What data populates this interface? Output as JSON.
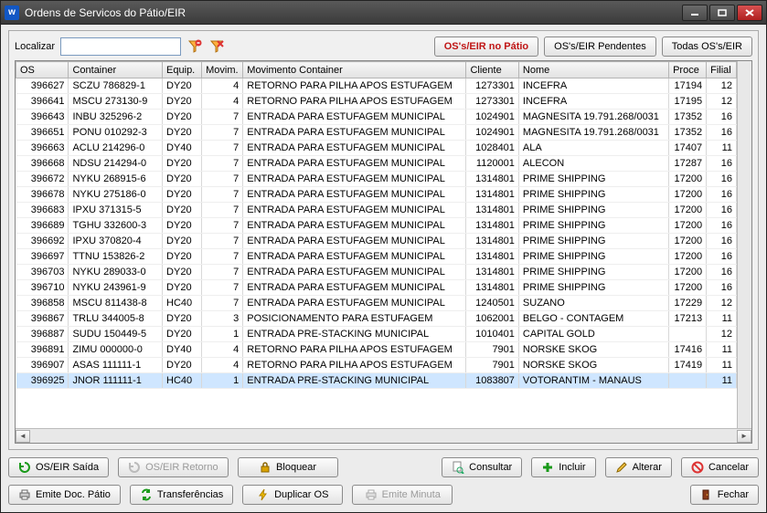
{
  "window": {
    "title": "Ordens de Servicos do Pátio/EIR"
  },
  "search": {
    "label": "Localizar",
    "value": ""
  },
  "filters": {
    "no_patio": "OS's/EIR no Pátio",
    "pendentes": "OS's/EIR Pendentes",
    "todas": "Todas OS's/EIR"
  },
  "columns": {
    "os": "OS",
    "container": "Container",
    "equip": "Equip.",
    "movim": "Movim.",
    "mov_container": "Movimento Container",
    "cliente": "Cliente",
    "nome": "Nome",
    "proce": "Proce",
    "filial": "Filial"
  },
  "rows": [
    {
      "os": "396627",
      "container": "SCZU 786829-1",
      "equip": "DY20",
      "movim": "4",
      "mov": "RETORNO PARA PILHA APOS ESTUFAGEM",
      "cliente": "1273301",
      "nome": "INCEFRA",
      "proce": "17194",
      "filial": "12"
    },
    {
      "os": "396641",
      "container": "MSCU 273130-9",
      "equip": "DY20",
      "movim": "4",
      "mov": "RETORNO PARA PILHA APOS ESTUFAGEM",
      "cliente": "1273301",
      "nome": "INCEFRA",
      "proce": "17195",
      "filial": "12"
    },
    {
      "os": "396643",
      "container": "INBU 325296-2",
      "equip": "DY20",
      "movim": "7",
      "mov": "ENTRADA PARA ESTUFAGEM MUNICIPAL",
      "cliente": "1024901",
      "nome": "MAGNESITA 19.791.268/0031",
      "proce": "17352",
      "filial": "16"
    },
    {
      "os": "396651",
      "container": "PONU 010292-3",
      "equip": "DY20",
      "movim": "7",
      "mov": "ENTRADA PARA ESTUFAGEM MUNICIPAL",
      "cliente": "1024901",
      "nome": "MAGNESITA 19.791.268/0031",
      "proce": "17352",
      "filial": "16"
    },
    {
      "os": "396663",
      "container": "ACLU 214296-0",
      "equip": "DY40",
      "movim": "7",
      "mov": "ENTRADA PARA ESTUFAGEM MUNICIPAL",
      "cliente": "1028401",
      "nome": "ALA",
      "proce": "17407",
      "filial": "11"
    },
    {
      "os": "396668",
      "container": "NDSU 214294-0",
      "equip": "DY20",
      "movim": "7",
      "mov": "ENTRADA PARA ESTUFAGEM MUNICIPAL",
      "cliente": "1120001",
      "nome": "ALECON",
      "proce": "17287",
      "filial": "16"
    },
    {
      "os": "396672",
      "container": "NYKU 268915-6",
      "equip": "DY20",
      "movim": "7",
      "mov": "ENTRADA PARA ESTUFAGEM MUNICIPAL",
      "cliente": "1314801",
      "nome": "PRIME SHIPPING",
      "proce": "17200",
      "filial": "16"
    },
    {
      "os": "396678",
      "container": "NYKU 275186-0",
      "equip": "DY20",
      "movim": "7",
      "mov": "ENTRADA PARA ESTUFAGEM MUNICIPAL",
      "cliente": "1314801",
      "nome": "PRIME SHIPPING",
      "proce": "17200",
      "filial": "16"
    },
    {
      "os": "396683",
      "container": "IPXU 371315-5",
      "equip": "DY20",
      "movim": "7",
      "mov": "ENTRADA PARA ESTUFAGEM MUNICIPAL",
      "cliente": "1314801",
      "nome": "PRIME SHIPPING",
      "proce": "17200",
      "filial": "16"
    },
    {
      "os": "396689",
      "container": "TGHU 332600-3",
      "equip": "DY20",
      "movim": "7",
      "mov": "ENTRADA PARA ESTUFAGEM MUNICIPAL",
      "cliente": "1314801",
      "nome": "PRIME SHIPPING",
      "proce": "17200",
      "filial": "16"
    },
    {
      "os": "396692",
      "container": "IPXU 370820-4",
      "equip": "DY20",
      "movim": "7",
      "mov": "ENTRADA PARA ESTUFAGEM MUNICIPAL",
      "cliente": "1314801",
      "nome": "PRIME SHIPPING",
      "proce": "17200",
      "filial": "16"
    },
    {
      "os": "396697",
      "container": "TTNU 153826-2",
      "equip": "DY20",
      "movim": "7",
      "mov": "ENTRADA PARA ESTUFAGEM MUNICIPAL",
      "cliente": "1314801",
      "nome": "PRIME SHIPPING",
      "proce": "17200",
      "filial": "16"
    },
    {
      "os": "396703",
      "container": "NYKU 289033-0",
      "equip": "DY20",
      "movim": "7",
      "mov": "ENTRADA PARA ESTUFAGEM MUNICIPAL",
      "cliente": "1314801",
      "nome": "PRIME SHIPPING",
      "proce": "17200",
      "filial": "16"
    },
    {
      "os": "396710",
      "container": "NYKU 243961-9",
      "equip": "DY20",
      "movim": "7",
      "mov": "ENTRADA PARA ESTUFAGEM MUNICIPAL",
      "cliente": "1314801",
      "nome": "PRIME SHIPPING",
      "proce": "17200",
      "filial": "16"
    },
    {
      "os": "396858",
      "container": "MSCU 811438-8",
      "equip": "HC40",
      "movim": "7",
      "mov": "ENTRADA PARA ESTUFAGEM MUNICIPAL",
      "cliente": "1240501",
      "nome": "SUZANO",
      "proce": "17229",
      "filial": "12"
    },
    {
      "os": "396867",
      "container": "TRLU 344005-8",
      "equip": "DY20",
      "movim": "3",
      "mov": "POSICIONAMENTO PARA ESTUFAGEM",
      "cliente": "1062001",
      "nome": "BELGO - CONTAGEM",
      "proce": "17213",
      "filial": "11"
    },
    {
      "os": "396887",
      "container": "SUDU 150449-5",
      "equip": "DY20",
      "movim": "1",
      "mov": "ENTRADA PRE-STACKING MUNICIPAL",
      "cliente": "1010401",
      "nome": "CAPITAL GOLD",
      "proce": "",
      "filial": "12"
    },
    {
      "os": "396891",
      "container": "ZIMU 000000-0",
      "equip": "DY40",
      "movim": "4",
      "mov": "RETORNO PARA PILHA APOS ESTUFAGEM",
      "cliente": "7901",
      "nome": "NORSKE SKOG",
      "proce": "17416",
      "filial": "11"
    },
    {
      "os": "396907",
      "container": "ASAS 111111-1",
      "equip": "DY20",
      "movim": "4",
      "mov": "RETORNO PARA PILHA APOS ESTUFAGEM",
      "cliente": "7901",
      "nome": "NORSKE SKOG",
      "proce": "17419",
      "filial": "11"
    },
    {
      "os": "396925",
      "container": "JNOR 111111-1",
      "equip": "HC40",
      "movim": "1",
      "mov": "ENTRADA PRE-STACKING MUNICIPAL",
      "cliente": "1083807",
      "nome": "VOTORANTIM - MANAUS",
      "proce": "",
      "filial": "11",
      "selected": true
    }
  ],
  "buttons": {
    "os_eir_saida": "OS/EIR Saída",
    "os_eir_retorno": "OS/EIR Retorno",
    "bloquear": "Bloquear",
    "consultar": "Consultar",
    "incluir": "Incluir",
    "alterar": "Alterar",
    "cancelar": "Cancelar",
    "emite_doc": "Emite Doc. Pátio",
    "transferencias": "Transferências",
    "duplicar_os": "Duplicar OS",
    "emite_minuta": "Emite Minuta",
    "fechar": "Fechar"
  }
}
